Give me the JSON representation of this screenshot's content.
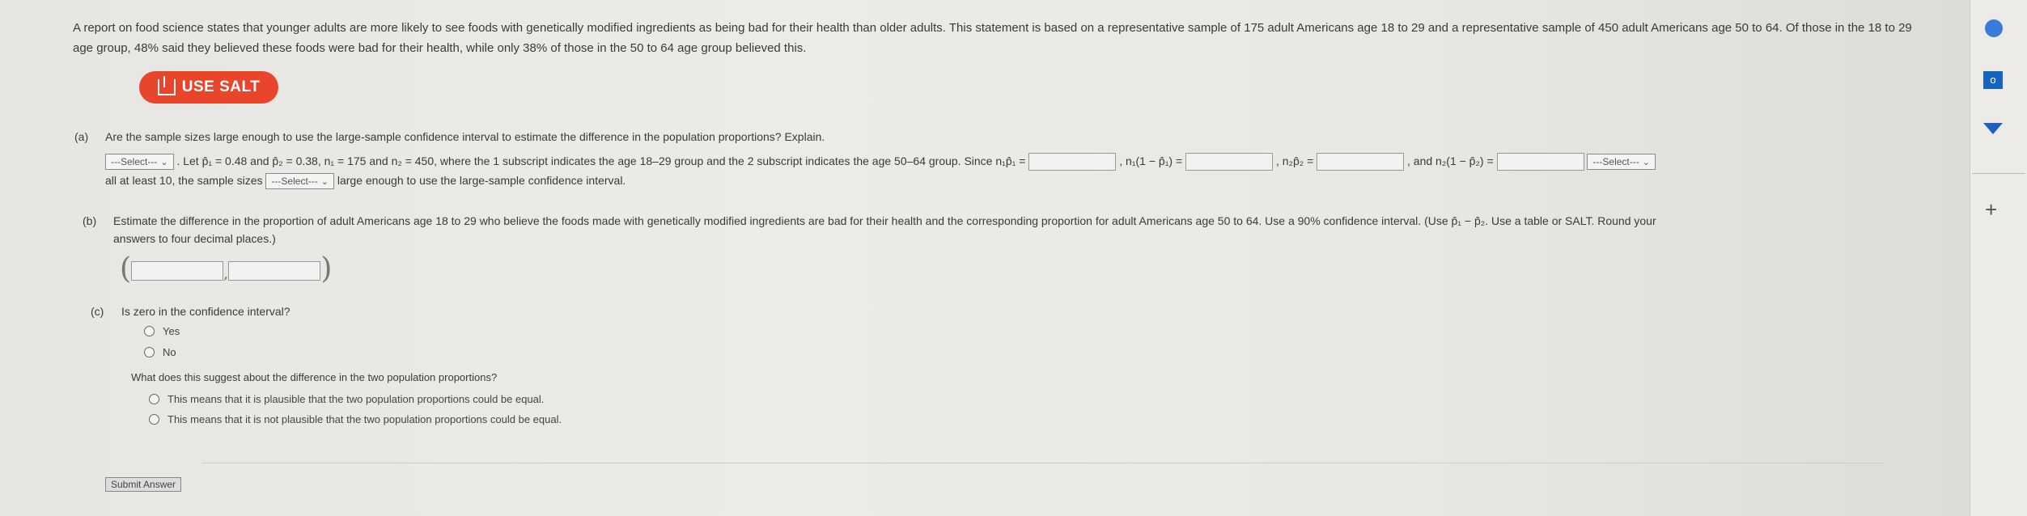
{
  "intro": "A report on food science states that younger adults are more likely to see foods with genetically modified ingredients as being bad for their health than older adults. This statement is based on a representative sample of 175 adult Americans age 18 to 29 and a representative sample of 450 adult Americans age 50 to 64. Of those in the 18 to 29 age group, 48% said they believed these foods were bad for their health, while only 38% of those in the 50 to 64 age group believed this.",
  "salt_label": "USE SALT",
  "part_a": {
    "label": "(a)",
    "question": "Are the sample sizes large enough to use the large-sample confidence interval to estimate the difference in the population proportions? Explain.",
    "select_placeholder": "---Select---",
    "text1": ". Let p̂₁ = 0.48 and p̂₂ = 0.38, n₁ = 175 and n₂ = 450, where the 1 subscript indicates the age 18–29 group and the 2 subscript indicates the age 50–64 group. Since n₁p̂₁ =",
    "t_n1q1": ", n₁(1 − p̂₁) =",
    "t_n2p2": ", n₂p̂₂ =",
    "t_n2q2": ", and n₂(1 − p̂₂) =",
    "line2_a": "all at least 10, the sample sizes",
    "line2_b": "large enough to use the large-sample confidence interval."
  },
  "part_b": {
    "label": "(b)",
    "text": "Estimate the difference in the proportion of adult Americans age 18 to 29 who believe the foods made with genetically modified ingredients are bad for their health and the corresponding proportion for adult Americans age 50 to 64. Use a 90% confidence interval. (Use p̂₁ − p̂₂. Use a table or SALT. Round your",
    "text2": "answers to four decimal places.)"
  },
  "part_c": {
    "label": "(c)",
    "question": "Is zero in the confidence interval?",
    "opt_yes": "Yes",
    "opt_no": "No",
    "q2": "What does this suggest about the difference in the two population proportions?",
    "opt1": "This means that it is plausible that the two population proportions could be equal.",
    "opt2": "This means that it is not plausible that the two population proportions could be equal."
  },
  "submit_label": "Submit Answer",
  "icons": {
    "salt": "salt-icon",
    "plus": "+"
  }
}
